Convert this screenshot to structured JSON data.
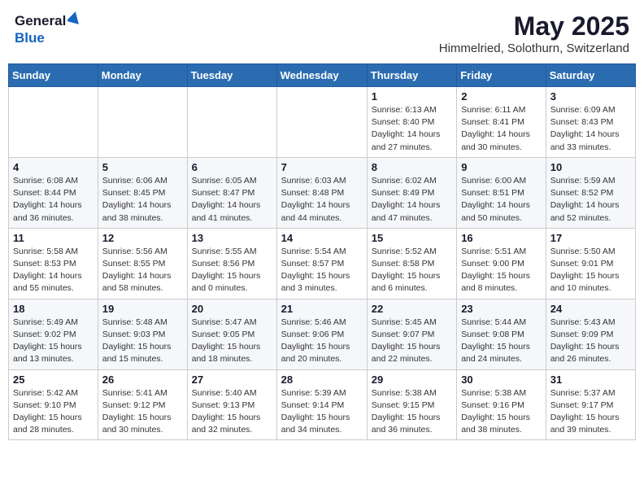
{
  "header": {
    "logo_general": "General",
    "logo_blue": "Blue",
    "title": "May 2025",
    "subtitle": "Himmelried, Solothurn, Switzerland"
  },
  "days_of_week": [
    "Sunday",
    "Monday",
    "Tuesday",
    "Wednesday",
    "Thursday",
    "Friday",
    "Saturday"
  ],
  "weeks": [
    [
      {
        "day": "",
        "info": ""
      },
      {
        "day": "",
        "info": ""
      },
      {
        "day": "",
        "info": ""
      },
      {
        "day": "",
        "info": ""
      },
      {
        "day": "1",
        "info": "Sunrise: 6:13 AM\nSunset: 8:40 PM\nDaylight: 14 hours\nand 27 minutes."
      },
      {
        "day": "2",
        "info": "Sunrise: 6:11 AM\nSunset: 8:41 PM\nDaylight: 14 hours\nand 30 minutes."
      },
      {
        "day": "3",
        "info": "Sunrise: 6:09 AM\nSunset: 8:43 PM\nDaylight: 14 hours\nand 33 minutes."
      }
    ],
    [
      {
        "day": "4",
        "info": "Sunrise: 6:08 AM\nSunset: 8:44 PM\nDaylight: 14 hours\nand 36 minutes."
      },
      {
        "day": "5",
        "info": "Sunrise: 6:06 AM\nSunset: 8:45 PM\nDaylight: 14 hours\nand 38 minutes."
      },
      {
        "day": "6",
        "info": "Sunrise: 6:05 AM\nSunset: 8:47 PM\nDaylight: 14 hours\nand 41 minutes."
      },
      {
        "day": "7",
        "info": "Sunrise: 6:03 AM\nSunset: 8:48 PM\nDaylight: 14 hours\nand 44 minutes."
      },
      {
        "day": "8",
        "info": "Sunrise: 6:02 AM\nSunset: 8:49 PM\nDaylight: 14 hours\nand 47 minutes."
      },
      {
        "day": "9",
        "info": "Sunrise: 6:00 AM\nSunset: 8:51 PM\nDaylight: 14 hours\nand 50 minutes."
      },
      {
        "day": "10",
        "info": "Sunrise: 5:59 AM\nSunset: 8:52 PM\nDaylight: 14 hours\nand 52 minutes."
      }
    ],
    [
      {
        "day": "11",
        "info": "Sunrise: 5:58 AM\nSunset: 8:53 PM\nDaylight: 14 hours\nand 55 minutes."
      },
      {
        "day": "12",
        "info": "Sunrise: 5:56 AM\nSunset: 8:55 PM\nDaylight: 14 hours\nand 58 minutes."
      },
      {
        "day": "13",
        "info": "Sunrise: 5:55 AM\nSunset: 8:56 PM\nDaylight: 15 hours\nand 0 minutes."
      },
      {
        "day": "14",
        "info": "Sunrise: 5:54 AM\nSunset: 8:57 PM\nDaylight: 15 hours\nand 3 minutes."
      },
      {
        "day": "15",
        "info": "Sunrise: 5:52 AM\nSunset: 8:58 PM\nDaylight: 15 hours\nand 6 minutes."
      },
      {
        "day": "16",
        "info": "Sunrise: 5:51 AM\nSunset: 9:00 PM\nDaylight: 15 hours\nand 8 minutes."
      },
      {
        "day": "17",
        "info": "Sunrise: 5:50 AM\nSunset: 9:01 PM\nDaylight: 15 hours\nand 10 minutes."
      }
    ],
    [
      {
        "day": "18",
        "info": "Sunrise: 5:49 AM\nSunset: 9:02 PM\nDaylight: 15 hours\nand 13 minutes."
      },
      {
        "day": "19",
        "info": "Sunrise: 5:48 AM\nSunset: 9:03 PM\nDaylight: 15 hours\nand 15 minutes."
      },
      {
        "day": "20",
        "info": "Sunrise: 5:47 AM\nSunset: 9:05 PM\nDaylight: 15 hours\nand 18 minutes."
      },
      {
        "day": "21",
        "info": "Sunrise: 5:46 AM\nSunset: 9:06 PM\nDaylight: 15 hours\nand 20 minutes."
      },
      {
        "day": "22",
        "info": "Sunrise: 5:45 AM\nSunset: 9:07 PM\nDaylight: 15 hours\nand 22 minutes."
      },
      {
        "day": "23",
        "info": "Sunrise: 5:44 AM\nSunset: 9:08 PM\nDaylight: 15 hours\nand 24 minutes."
      },
      {
        "day": "24",
        "info": "Sunrise: 5:43 AM\nSunset: 9:09 PM\nDaylight: 15 hours\nand 26 minutes."
      }
    ],
    [
      {
        "day": "25",
        "info": "Sunrise: 5:42 AM\nSunset: 9:10 PM\nDaylight: 15 hours\nand 28 minutes."
      },
      {
        "day": "26",
        "info": "Sunrise: 5:41 AM\nSunset: 9:12 PM\nDaylight: 15 hours\nand 30 minutes."
      },
      {
        "day": "27",
        "info": "Sunrise: 5:40 AM\nSunset: 9:13 PM\nDaylight: 15 hours\nand 32 minutes."
      },
      {
        "day": "28",
        "info": "Sunrise: 5:39 AM\nSunset: 9:14 PM\nDaylight: 15 hours\nand 34 minutes."
      },
      {
        "day": "29",
        "info": "Sunrise: 5:38 AM\nSunset: 9:15 PM\nDaylight: 15 hours\nand 36 minutes."
      },
      {
        "day": "30",
        "info": "Sunrise: 5:38 AM\nSunset: 9:16 PM\nDaylight: 15 hours\nand 38 minutes."
      },
      {
        "day": "31",
        "info": "Sunrise: 5:37 AM\nSunset: 9:17 PM\nDaylight: 15 hours\nand 39 minutes."
      }
    ]
  ]
}
